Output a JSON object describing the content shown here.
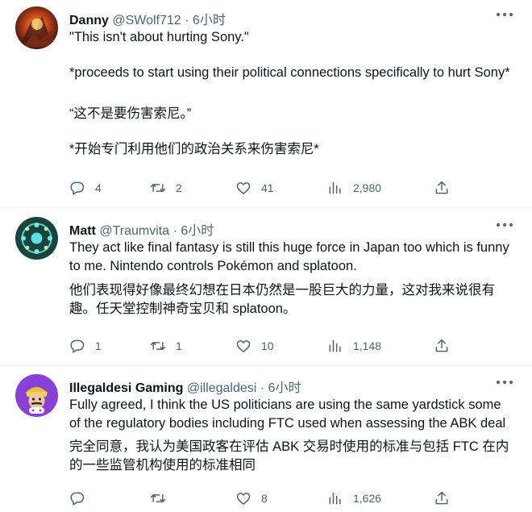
{
  "tweets": [
    {
      "name": "Danny",
      "handle": "@SWolf712",
      "sep": "·",
      "time": "6小时",
      "paragraphs": [
        "\"This isn't about hurting Sony.\"",
        "*proceeds to start using their political connections specifically to hurt Sony*",
        "“这不是要伤害索尼。”",
        "*开始专门利用他们的政治关系来伤害索尼*"
      ],
      "replies": "4",
      "retweets": "2",
      "likes": "41",
      "views": "2,980"
    },
    {
      "name": "Matt",
      "handle": "@Traumvita",
      "sep": "·",
      "time": "6小时",
      "paragraphs": [
        "They act like final fantasy is still this huge force in Japan too which is funny to me. Nintendo controls Pokémon and splatoon.",
        "他们表现得好像最终幻想在日本仍然是一股巨大的力量，这对我来说很有趣。任天堂控制神奇宝贝和 splatoon。"
      ],
      "replies": "1",
      "retweets": "1",
      "likes": "10",
      "views": "1,148"
    },
    {
      "name": "Illegaldesi Gaming",
      "handle": "@illegaldesi",
      "sep": "·",
      "time": "6小时",
      "paragraphs": [
        "Fully agreed, I think the US politicians are using the same yardstick some of the regulatory bodies including FTC used when assessing the ABK deal",
        "完全同意，我认为美国政客在评估 ABK 交易时使用的标准与包括 FTC 在内的一些监管机构使用的标准相同"
      ],
      "replies": "",
      "retweets": "",
      "likes": "8",
      "views": "1,626"
    }
  ],
  "icons": {
    "reply": "reply-icon",
    "retweet": "retweet-icon",
    "like": "like-icon",
    "views": "views-icon",
    "share": "share-icon",
    "more": "more-icon"
  },
  "colors": {
    "text": "#0f1419",
    "secondary": "#536471",
    "divider": "#eff3f4"
  }
}
